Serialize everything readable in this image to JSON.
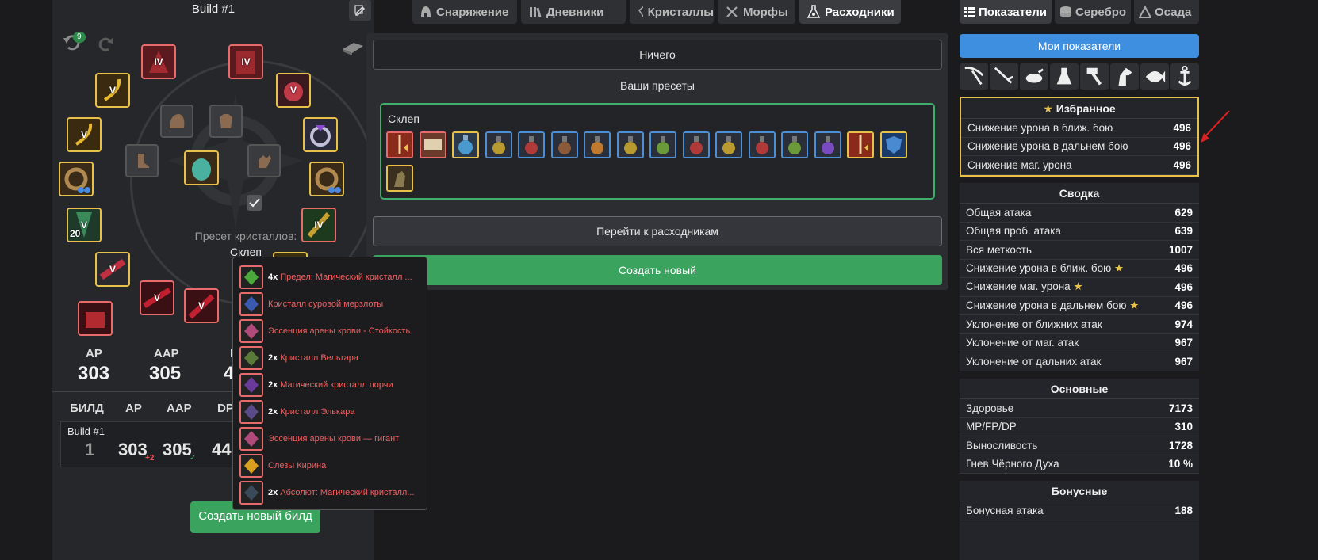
{
  "build": {
    "title": "Build #1",
    "undo_count": "9",
    "slot_levels": [
      "IV",
      "IV",
      "V",
      "V",
      "V",
      "V",
      "V",
      "IV",
      "20",
      "V",
      "V",
      "V",
      "V"
    ],
    "crystal_preset_label": "Пресет кристаллов:",
    "crystal_preset_name": "Склеп",
    "ap_label": "AP",
    "ap_value": "303",
    "aap_label": "AAP",
    "aap_value": "305",
    "dp_label_partial": "I",
    "dp_value_partial": "4",
    "table_headers": [
      "БИЛД",
      "AP",
      "AAP",
      "DP"
    ],
    "row": {
      "name": "Build #1",
      "rank": "1",
      "ap": "303",
      "ap_delta": "+2",
      "aap": "305",
      "dp_partial": "44"
    },
    "create_build_label": "Создать новый билд"
  },
  "tabs": [
    {
      "label": "Снаряжение",
      "icon": "helmet-icon",
      "active": false
    },
    {
      "label": "Дневники",
      "icon": "books-icon",
      "active": false
    },
    {
      "label": "Кристаллы",
      "icon": "crystal-icon",
      "active": false
    },
    {
      "label": "Морфы",
      "icon": "tools-icon",
      "active": false
    },
    {
      "label": "Расходники",
      "icon": "flask-icon",
      "active": true
    }
  ],
  "center": {
    "nothing_label": "Ничего",
    "presets_title": "Ваши пресеты",
    "preset_name": "Склеп",
    "preset_items": [
      {
        "border": "red",
        "icon": "red-buff-icon"
      },
      {
        "border": "red",
        "icon": "scroll-icon"
      },
      {
        "border": "gold",
        "icon": "blue-perfume-icon"
      },
      {
        "border": "blue",
        "icon": "yellow-elixir-icon"
      },
      {
        "border": "blue",
        "icon": "red-elixir-icon"
      },
      {
        "border": "blue",
        "icon": "brown-elixir-icon"
      },
      {
        "border": "blue",
        "icon": "orange-elixir-icon"
      },
      {
        "border": "blue",
        "icon": "yellow-elixir-icon"
      },
      {
        "border": "blue",
        "icon": "green-elixir-icon"
      },
      {
        "border": "blue",
        "icon": "red-elixir-icon"
      },
      {
        "border": "blue",
        "icon": "yellow-elixir-icon"
      },
      {
        "border": "blue",
        "icon": "red-elixir-icon"
      },
      {
        "border": "blue",
        "icon": "green-elixir-icon"
      },
      {
        "border": "blue",
        "icon": "purple-elixir-icon"
      },
      {
        "border": "gold",
        "icon": "attack-buff-icon"
      },
      {
        "border": "gold",
        "icon": "shield-buff-icon"
      },
      {
        "border": "gold",
        "icon": "deer-statue-icon"
      }
    ],
    "goto_label": "Перейти к расходникам",
    "create_new_label": "Создать новый"
  },
  "popup": [
    {
      "qty": "4x",
      "name": "Предел: Магический кристалл ...",
      "color": "#4aa93a"
    },
    {
      "qty": "",
      "name": "Кристалл суровой мерзлоты",
      "color": "#3a5ab0"
    },
    {
      "qty": "",
      "name": "Эссенция арены крови - Стойкость",
      "color": "#b04a7a"
    },
    {
      "qty": "2x",
      "name": "Кристалл Вельтара",
      "color": "#5a7a3a"
    },
    {
      "qty": "2x",
      "name": "Магический кристалл порчи",
      "color": "#6a3a9a"
    },
    {
      "qty": "2x",
      "name": "Кристалл Элькара",
      "color": "#5a4a8a"
    },
    {
      "qty": "",
      "name": "Эссенция арены крови — гигант",
      "color": "#b04a7a"
    },
    {
      "qty": "",
      "name": "Слезы Кирина",
      "color": "#d9a020"
    },
    {
      "qty": "2x",
      "name": "Абсолют: Магический кристалл...",
      "color": "#3a4a5a"
    }
  ],
  "right_tabs": [
    {
      "label": "Показатели",
      "icon": "list-icon",
      "active": true
    },
    {
      "label": "Серебро",
      "icon": "coins-icon",
      "active": false
    },
    {
      "label": "Осада",
      "icon": "castle-icon",
      "active": false
    }
  ],
  "my_stats_label": "Мои показатели",
  "categories": [
    "pickaxe-icon",
    "fishing-rod-icon",
    "cooking-icon",
    "alchemy-icon",
    "hammer-icon",
    "horse-icon",
    "fish-icon",
    "anchor-icon"
  ],
  "favorites": {
    "title": "Избранное",
    "rows": [
      {
        "label": "Снижение урона в ближ. бою",
        "value": "496"
      },
      {
        "label": "Снижение урона в дальнем бою",
        "value": "496"
      },
      {
        "label": "Снижение маг. урона",
        "value": "496"
      }
    ]
  },
  "summary": {
    "title": "Сводка",
    "rows": [
      {
        "label": "Общая атака",
        "value": "629",
        "star": false
      },
      {
        "label": "Общая проб. атака",
        "value": "639",
        "star": false
      },
      {
        "label": "Вся меткость",
        "value": "1007",
        "star": false
      },
      {
        "label": "Снижение урона в ближ. бою",
        "value": "496",
        "star": true
      },
      {
        "label": "Снижение маг. урона",
        "value": "496",
        "star": true
      },
      {
        "label": "Снижение урона в дальнем бою",
        "value": "496",
        "star": true
      },
      {
        "label": "Уклонение от ближних атак",
        "value": "974",
        "star": false
      },
      {
        "label": "Уклонение от маг. атак",
        "value": "967",
        "star": false
      },
      {
        "label": "Уклонение от дальних атак",
        "value": "967",
        "star": false
      }
    ]
  },
  "main_stats": {
    "title": "Основные",
    "rows": [
      {
        "label": "Здоровье",
        "value": "7173"
      },
      {
        "label": "MP/FP/DP",
        "value": "310"
      },
      {
        "label": "Выносливость",
        "value": "1728"
      },
      {
        "label": "Гнев Чёрного Духа",
        "value": "10 %"
      }
    ]
  },
  "bonus": {
    "title": "Бонусные",
    "rows": [
      {
        "label": "Бонусная атака",
        "value": "188"
      }
    ]
  }
}
